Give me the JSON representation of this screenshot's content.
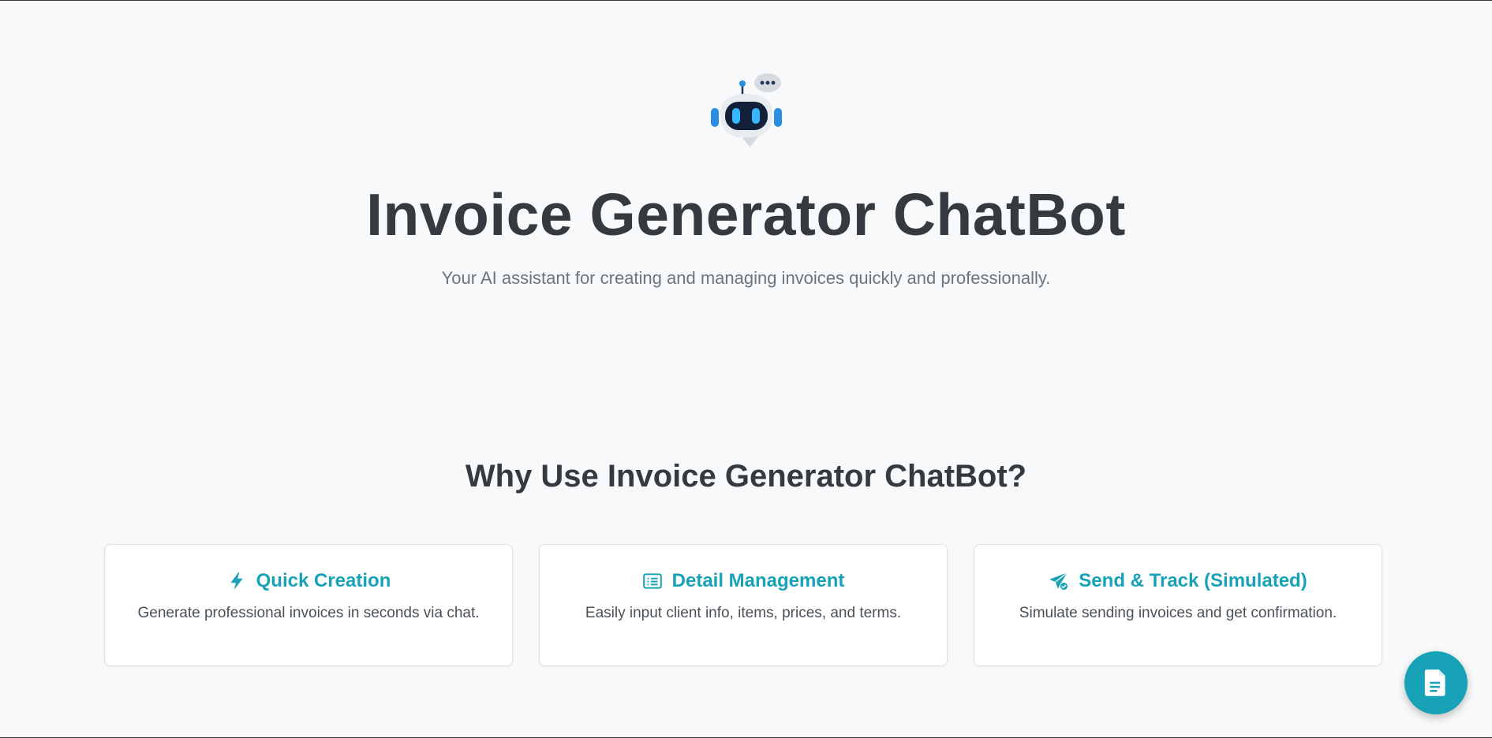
{
  "hero": {
    "logo_icon": "robot-chat-icon",
    "title": "Invoice Generator ChatBot",
    "subtitle": "Your AI assistant for creating and managing invoices quickly and professionally."
  },
  "features": {
    "heading": "Why Use Invoice Generator ChatBot?",
    "items": [
      {
        "icon": "lightning-bolt-icon",
        "title": "Quick Creation",
        "description": "Generate professional invoices in seconds via chat."
      },
      {
        "icon": "list-details-icon",
        "title": "Detail Management",
        "description": "Easily input client info, items, prices, and terms."
      },
      {
        "icon": "paper-plane-check-icon",
        "title": "Send & Track (Simulated)",
        "description": "Simulate sending invoices and get confirmation."
      }
    ]
  },
  "fab": {
    "icon": "document-icon"
  },
  "colors": {
    "accent": "#17a2b8",
    "heading": "#343a40",
    "muted": "#6c757d",
    "background": "#f8f9fa"
  }
}
